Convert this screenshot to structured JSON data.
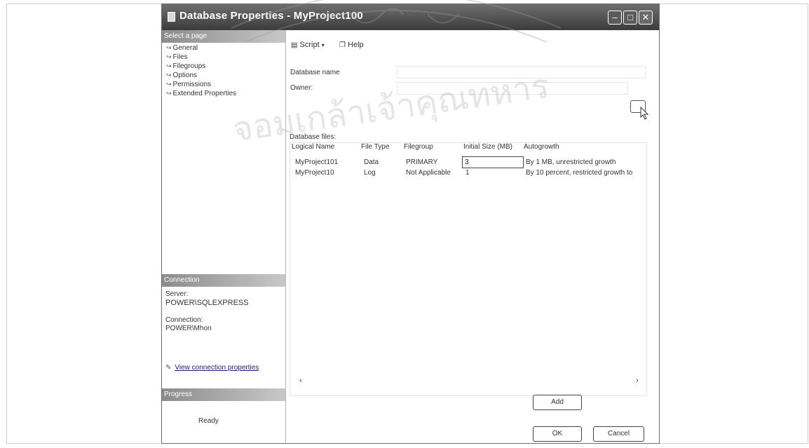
{
  "window": {
    "title": "Database Properties - MyProject100",
    "controls": [
      "minimize",
      "maximize",
      "close"
    ]
  },
  "left": {
    "select_page_header": "Select a page",
    "pages": [
      "General",
      "Files",
      "Filegroups",
      "Options",
      "Permissions",
      "Extended Properties"
    ],
    "connection_header": "Connection",
    "server_label": "Server:",
    "server_value": "POWER\\SQLEXPRESS",
    "connection_label": "Connection:",
    "connection_value": "POWER\\Mhon",
    "view_link": "View connection properties",
    "progress_header": "Progress",
    "status": "Ready"
  },
  "toolbar": {
    "script_label": "Script",
    "help_label": "Help"
  },
  "form": {
    "database_name_label": "Database name",
    "database_name_value": "",
    "owner_label": "Owner:",
    "owner_value": ""
  },
  "files": {
    "label": "Database files:",
    "columns": [
      "Logical Name",
      "File Type",
      "Filegroup",
      "Initial Size (MB)",
      "Autogrowth"
    ],
    "rows": [
      [
        "MyProject101",
        "Data",
        "PRIMARY",
        "3",
        "By 1 MB, unrestricted growth"
      ],
      [
        "MyProject10",
        "Log",
        "Not Applicable",
        "1",
        "By 10 percent, restricted growth to"
      ]
    ]
  },
  "buttons": {
    "add": "Add",
    "ok": "OK",
    "cancel": "Cancel"
  },
  "watermark_text": "จอมเกล้าเจ้าคุณทหาร"
}
